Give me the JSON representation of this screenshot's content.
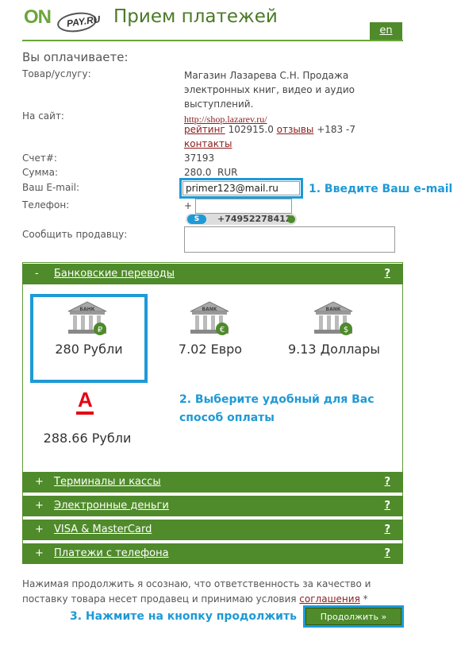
{
  "header": {
    "logo_main": "ON",
    "logo_sub": "PAY.RU",
    "title": "Прием платежей",
    "lang_link": "en"
  },
  "order": {
    "heading": "Вы оплачиваете:",
    "product_label": "Товар/услугу:",
    "product_value": "Магазин Лазарева С.Н. Продажа электронных книг, видео и аудио выступлений.",
    "site_label": "На сайт:",
    "site_url": "http://shop.lazarev.ru/",
    "rating_link": "рейтинг",
    "rating_value": "102915.0",
    "reviews_link": "отзывы",
    "reviews_value": "+183 -7",
    "contacts_link": "контакты",
    "invoice_label": "Счет#:",
    "invoice_value": "37193",
    "sum_label": "Сумма:",
    "sum_value": "280.0  RUR",
    "email_label": "Ваш E-mail:",
    "email_value": "primer123@mail.ru",
    "phone_label": "Телефон:",
    "phone_prefix": "+",
    "skype_number": "+74952278412",
    "message_label": "Сообщить продавцу:",
    "message_value": ""
  },
  "steps": {
    "step1": "1. Введите Ваш e-mail",
    "step2": "2. Выберите удобный для Вас способ оплаты",
    "step3": "3. Нажмите на кнопку продолжить"
  },
  "payment": {
    "bank_section": {
      "sign": "-",
      "label": "Банковские переводы",
      "help": "?"
    },
    "bank_icon_text": "БАНК",
    "bank_icon_text_en": "BANK",
    "options": [
      {
        "amount": "280 Рубли",
        "coin": "₽",
        "coin_color": "#4f8a2b"
      },
      {
        "amount": "7.02 Евро",
        "coin": "€",
        "coin_color": "#4f8a2b"
      },
      {
        "amount": "9.13 Доллары",
        "coin": "$",
        "coin_color": "#4f8a2b"
      }
    ],
    "alfa_amount": "288.66 Рубли",
    "alfa_letter": "А",
    "sections": [
      {
        "sign": "+",
        "label": "Терминалы и кассы",
        "help": "?"
      },
      {
        "sign": "+",
        "label": "Электронные деньги",
        "help": "?"
      },
      {
        "sign": "+",
        "label": "VISA & MasterCard",
        "help": "?"
      },
      {
        "sign": "+",
        "label": "Платежи с телефона",
        "help": "?"
      }
    ]
  },
  "footer": {
    "legal_text": "Нажимая продолжить я осознаю, что ответственность за качество и поставку товара несет продавец и принимаю условия",
    "agreement_link": "соглашения",
    "asterisk": "*",
    "continue_label": "Продолжить »"
  },
  "colors": {
    "brand_green": "#4f8a2b",
    "highlight_blue": "#1e9ad6",
    "link_red": "#8b1c1c",
    "alfa_red": "#e30613"
  }
}
